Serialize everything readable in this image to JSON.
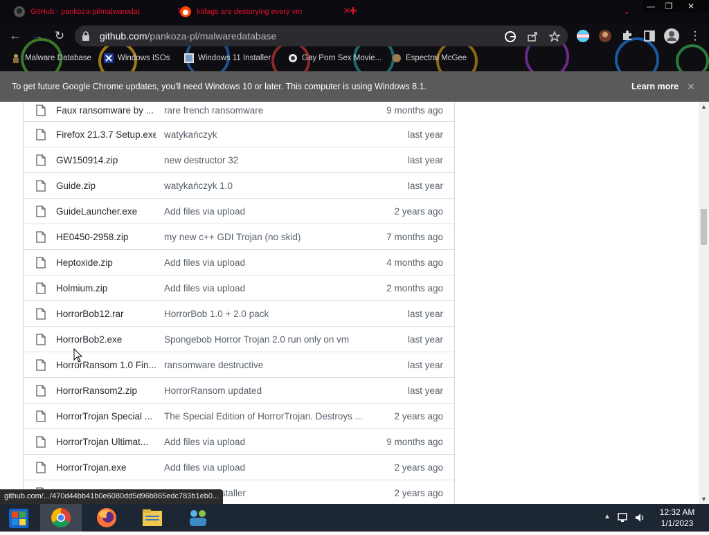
{
  "browser": {
    "tabs": [
      {
        "title": "GitHub - pankoza-pl/malwaredat",
        "close": "✕"
      },
      {
        "title": "kitfags are destorying every vm",
        "close": "✕"
      }
    ],
    "new_tab": "+",
    "tab_search": "⌄",
    "window_controls": {
      "minimize": "—",
      "maximize": "❐",
      "close": "✕"
    },
    "url_host": "github.com",
    "url_path": "/pankoza-pl/malwaredatabase",
    "nav": {
      "back": "←",
      "forward": "→",
      "reload": "↻"
    }
  },
  "bookmarks": [
    {
      "label": "Malware Database"
    },
    {
      "label": "Windows ISOs"
    },
    {
      "label": "Windows 11 Installer"
    },
    {
      "label": "Gay Porn Sex Movie..."
    },
    {
      "label": "Espectral McGee"
    }
  ],
  "infobar": {
    "message": "To get future Google Chrome updates, you'll need Windows 10 or later. This computer is using Windows 8.1.",
    "learn_more": "Learn more",
    "close": "✕"
  },
  "files": [
    {
      "name": "Faux ransomware by ...",
      "commit": "rare french ransomware",
      "age": "9 months ago"
    },
    {
      "name": "Firefox 21.3.7 Setup.exe",
      "commit": "watykańczyk",
      "age": "last year"
    },
    {
      "name": "GW150914.zip",
      "commit": "new destructor 32",
      "age": "last year"
    },
    {
      "name": "Guide.zip",
      "commit": "watykańczyk 1.0",
      "age": "last year"
    },
    {
      "name": "GuideLauncher.exe",
      "commit": "Add files via upload",
      "age": "2 years ago"
    },
    {
      "name": "HE0450-2958.zip",
      "commit": "my new c++ GDI Trojan (no skid)",
      "age": "7 months ago"
    },
    {
      "name": "Heptoxide.zip",
      "commit": "Add files via upload",
      "age": "4 months ago"
    },
    {
      "name": "Holmium.zip",
      "commit": "Add files via upload",
      "age": "2 months ago"
    },
    {
      "name": "HorrorBob12.rar",
      "commit": "HorrorBob 1.0 + 2.0 pack",
      "age": "last year"
    },
    {
      "name": "HorrorBob2.exe",
      "commit": "Spongebob Horror Trojan 2.0 run only on vm",
      "age": "last year"
    },
    {
      "name": "HorrorRansom 1.0 Fin...",
      "commit": "ransomware destructive",
      "age": "last year"
    },
    {
      "name": "HorrorRansom2.zip",
      "commit": "HorrorRansom updated",
      "age": "last year"
    },
    {
      "name": "HorrorTrojan Special ...",
      "commit": "The Special Edition of HorrorTrojan. Destroys ...",
      "age": "2 years ago"
    },
    {
      "name": "HorrorTrojan Ultimat...",
      "commit": "Add files via upload",
      "age": "9 months ago"
    },
    {
      "name": "HorrorTrojan.exe",
      "commit": "Add files via upload",
      "age": "2 years ago"
    },
    {
      "name": "",
      "commit": "2.0 and 3.0 installer",
      "age": "2 years ago"
    }
  ],
  "status_url": "github.com/.../470d44bb41b0e6080dd5d96b865edc783b1eb0...",
  "clock": {
    "time": "12:32 AM",
    "date": "1/1/2023"
  },
  "colors": {
    "tab_text": "#e0102a",
    "infobar": "#5a5a5a",
    "taskbar": "#1d2733"
  }
}
